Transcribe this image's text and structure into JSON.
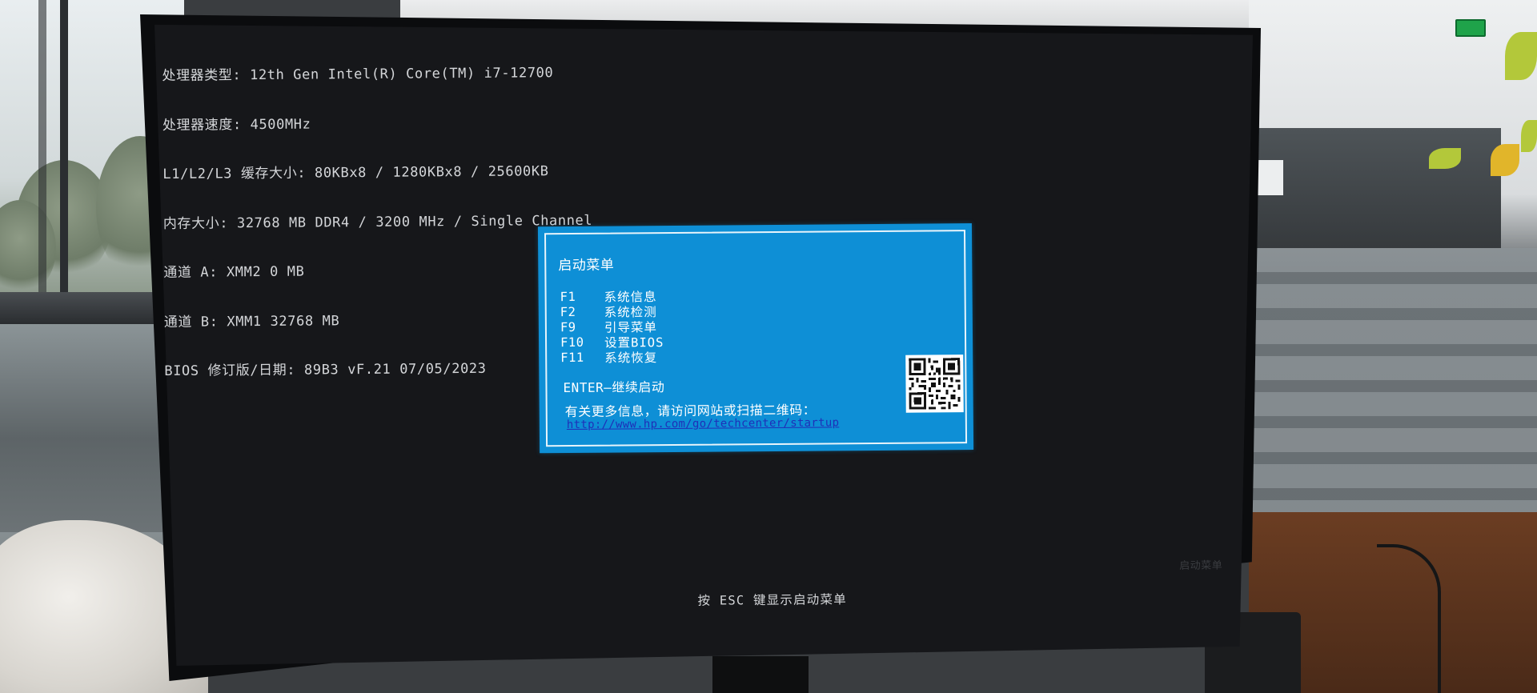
{
  "system_info": {
    "processor_type": "处理器类型: 12th Gen Intel(R) Core(TM) i7-12700",
    "processor_speed": "处理器速度: 4500MHz",
    "cache_size": "L1/L2/L3 缓存大小: 80KBx8 / 1280KBx8 / 25600KB",
    "memory_size": "内存大小: 32768 MB DDR4 / 3200 MHz / Single Channel",
    "channel_a": "通道 A: XMM2 0 MB",
    "channel_b": "通道 B: XMM1 32768 MB",
    "bios_revision": "BIOS 修订版/日期: 89B3 vF.21 07/05/2023"
  },
  "startup_menu": {
    "title": "启动菜单",
    "items": [
      {
        "key": "F1",
        "label": "系统信息"
      },
      {
        "key": "F2",
        "label": "系统检测"
      },
      {
        "key": "F9",
        "label": "引导菜单"
      },
      {
        "key": "F10",
        "label": "设置BIOS"
      },
      {
        "key": "F11",
        "label": "系统恢复"
      }
    ],
    "enter_line": "ENTER—继续启动",
    "more_info": "有关更多信息，请访问网站或扫描二维码：",
    "url": "http://www.hp.com/go/techcenter/startup",
    "qr_icon": "qr-code-icon"
  },
  "footer": {
    "esc_hint": "按 ESC 键显示启动菜单",
    "osd_text": "启动菜单"
  },
  "colors": {
    "menu_background": "#0e8fd6",
    "screen_background": "#16171a",
    "system_text": "#d4d6d9",
    "link": "#1f2fb8"
  }
}
